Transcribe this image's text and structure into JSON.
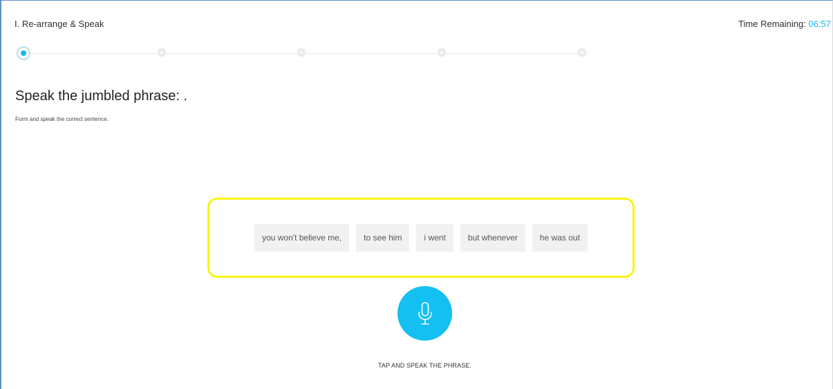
{
  "header": {
    "section_title": "I. Re-arrange & Speak",
    "timer_label": "Time Remaining: ",
    "timer_value": "06:57"
  },
  "progress": {
    "total_steps": 5,
    "current_step": 1
  },
  "question": {
    "title": "Speak the jumbled phrase: .",
    "instruction": "Form and speak the correct sentence."
  },
  "phrases": [
    "you won't believe me,",
    "to see him",
    "i went",
    "but whenever",
    "he was out"
  ],
  "mic": {
    "icon": "microphone-icon",
    "hint": "TAP AND SPEAK THE PHRASE."
  },
  "colors": {
    "accent": "#14bff2",
    "highlight_border": "#f5f513",
    "chip_bg": "#f1f1f1",
    "frame_border": "#5b8fc9"
  }
}
